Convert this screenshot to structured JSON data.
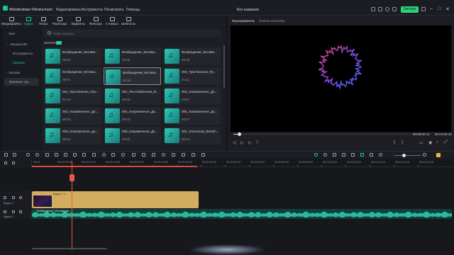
{
  "app": {
    "name": "Wondershare Filmora",
    "project_title": "Без названия",
    "export_label": "Экспорт"
  },
  "menu": [
    "Файл",
    "Редактировать",
    "Инструменты",
    "Посмотреть",
    "Помощь"
  ],
  "media_tabs": [
    {
      "label": "Медиафайлы",
      "icon": "media-icon"
    },
    {
      "label": "Аудио",
      "icon": "music-note-icon"
    },
    {
      "label": "Титры",
      "icon": "text-icon"
    },
    {
      "label": "Переходы",
      "icon": "transition-icon"
    },
    {
      "label": "Эффекты",
      "icon": "effects-icon"
    },
    {
      "label": "Фильтры",
      "icon": "filters-icon"
    },
    {
      "label": "Стикеры",
      "icon": "stickers-icon"
    },
    {
      "label": "Шаблоны",
      "icon": "templates-icon"
    }
  ],
  "active_media_tab": "Аудио",
  "sidebar": {
    "items": [
      {
        "label": "Мое",
        "sub": false
      },
      {
        "label": "Музыка ИИ",
        "sub": false
      },
      {
        "label": "Инструменты",
        "sub": true
      },
      {
        "label": "Скачать",
        "sub": true
      },
      {
        "label": "Музыка",
        "sub": false
      },
      {
        "label": "Звуковые эф...",
        "sub": false
      }
    ]
  },
  "search": {
    "placeholder": "Поиск музыки"
  },
  "downloads_label": "СКАЧАТЬ",
  "audio_items": [
    {
      "title": "Возбуждение_Мотива...",
      "duration": "05:01"
    },
    {
      "title": "Возбуждение_Мотива...",
      "duration": "05:05"
    },
    {
      "title": "Возбуждение_Мотива...",
      "duration": "05:05"
    },
    {
      "title": "Возбуждение_Мотива...",
      "duration": "05:01"
    },
    {
      "title": "Возбуждение_Мотива...",
      "duration": "04:18"
    },
    {
      "title": "003_Чувственная_Пр...",
      "duration": "01:11"
    },
    {
      "title": "001_Чувственное_Про...",
      "duration": "01:04"
    },
    {
      "title": "001_Расслабленная_В...",
      "duration": "05:03"
    },
    {
      "title": "003_Напряженное_До...",
      "duration": "05:07"
    },
    {
      "title": "002_Напряженное_До...",
      "duration": "05:03"
    },
    {
      "title": "004_Напряженное_До...",
      "duration": "05:03"
    },
    {
      "title": "005_Напряженное_До...",
      "duration": "05:07"
    },
    {
      "title": "003_Напряженное_До...",
      "duration": "05:01"
    },
    {
      "title": "005_Напряженное_До...",
      "duration": "05:03"
    },
    {
      "title": "002_Эпическая_Влюбл...",
      "duration": "05:24"
    }
  ],
  "player": {
    "tabs": [
      "Проигрыватель",
      "Полное качество"
    ],
    "current_time": "00:00:00:13",
    "total_time": "00:04:59:19",
    "progress": 0.03
  },
  "timeline": {
    "ruler_ticks": [
      "00:00",
      "00:00:05:00",
      "00:00:10:00",
      "00:00:15:00",
      "00:00:20:00",
      "00:00:25:00",
      "00:00:30:00",
      "00:00:35:00",
      "00:00:40:00",
      "00:00:45:00",
      "00:00:50:00",
      "00:00:55:00",
      "00:01:00:00",
      "00:01:05:00",
      "00:01:10:00",
      "00:01:15:00",
      "00:01:20:00"
    ],
    "video_track_label": "Видео 1",
    "audio_track_label": "Аудио 1",
    "video_clip_name": "Видео 1 1",
    "audio_clip_name": "Возбуждение_Мотивация..."
  },
  "colors": {
    "accent": "#18d1b0",
    "export": "#2fd37c",
    "video_clip": "#d3ad5f",
    "audio_clip": "#103f3a",
    "playhead": "#e25a4c"
  }
}
